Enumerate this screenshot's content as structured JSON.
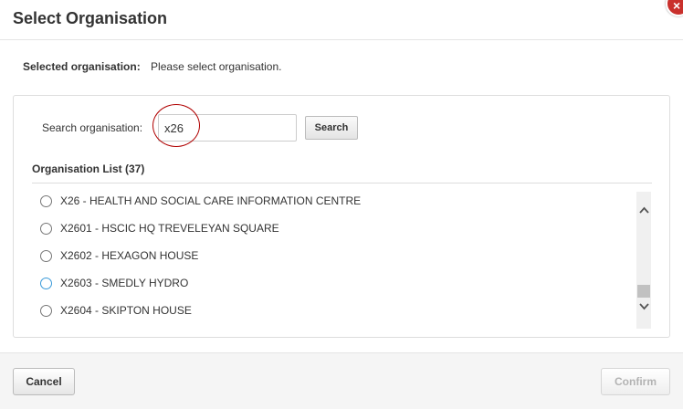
{
  "dialog": {
    "title": "Select Organisation",
    "close_icon": "×"
  },
  "selected": {
    "label": "Selected organisation:",
    "value": "Please select organisation."
  },
  "search": {
    "label": "Search organisation:",
    "value": "x26",
    "button_label": "Search"
  },
  "list": {
    "heading": "Organisation List (37)",
    "items": [
      {
        "label": "X26 - HEALTH AND SOCIAL CARE INFORMATION CENTRE",
        "focused": false
      },
      {
        "label": "X2601 - HSCIC HQ TREVELEYAN SQUARE",
        "focused": false
      },
      {
        "label": "X2602 - HEXAGON HOUSE",
        "focused": false
      },
      {
        "label": "X2603 - SMEDLY HYDRO",
        "focused": true
      },
      {
        "label": "X2604 - SKIPTON HOUSE",
        "focused": false
      }
    ],
    "scroll_up_icon": "chevron-up-icon",
    "scroll_down_icon": "chevron-down-icon"
  },
  "footer": {
    "cancel_label": "Cancel",
    "confirm_label": "Confirm"
  },
  "colors": {
    "close": "#c9302c",
    "highlight_circle": "#b00000",
    "radio_focus": "#3a9ad9",
    "confirm_disabled_text": "#b3b3b3"
  }
}
